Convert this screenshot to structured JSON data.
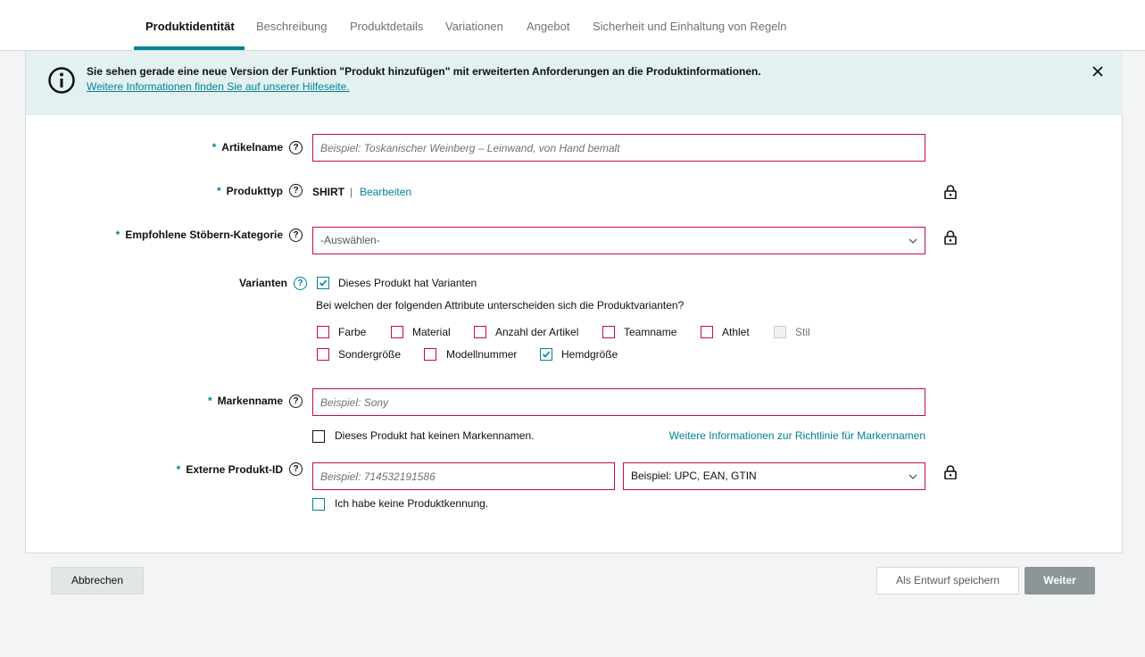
{
  "tabs": [
    {
      "label": "Produktidentität",
      "active": true
    },
    {
      "label": "Beschreibung",
      "active": false
    },
    {
      "label": "Produktdetails",
      "active": false
    },
    {
      "label": "Variationen",
      "active": false
    },
    {
      "label": "Angebot",
      "active": false
    },
    {
      "label": "Sicherheit und Einhaltung von Regeln",
      "active": false
    }
  ],
  "banner": {
    "title": "Sie sehen gerade eine neue Version der Funktion \"Produkt hinzufügen\" mit erweiterten Anforderungen an die Produktinformationen.",
    "link": "Weitere Informationen finden Sie auf unserer Hilfeseite."
  },
  "form": {
    "required_mark": "*",
    "help_glyph": "?",
    "item_name": {
      "label": "Artikelname",
      "placeholder": "Beispiel: Toskanischer Weinberg – Leinwand, von Hand bemalt",
      "value": ""
    },
    "product_type": {
      "label": "Produkttyp",
      "value": "SHIRT",
      "separator": "|",
      "edit_link": "Bearbeiten"
    },
    "browse_category": {
      "label": "Empfohlene Stöbern-Kategorie",
      "selected": "-Auswählen-"
    },
    "variants": {
      "label": "Varianten",
      "has_variants_label": "Dieses Produkt hat Varianten",
      "has_variants_checked": true,
      "question": "Bei welchen der folgenden Attribute unterscheiden sich die Produktvarianten?",
      "options": [
        {
          "label": "Farbe",
          "checked": false,
          "disabled": false
        },
        {
          "label": "Material",
          "checked": false,
          "disabled": false
        },
        {
          "label": "Anzahl der Artikel",
          "checked": false,
          "disabled": false
        },
        {
          "label": "Teamname",
          "checked": false,
          "disabled": false
        },
        {
          "label": "Athlet",
          "checked": false,
          "disabled": false
        },
        {
          "label": "Stil",
          "checked": false,
          "disabled": true
        },
        {
          "label": "Sondergröße",
          "checked": false,
          "disabled": false
        },
        {
          "label": "Modellnummer",
          "checked": false,
          "disabled": false
        },
        {
          "label": "Hemdgröße",
          "checked": true,
          "disabled": false
        }
      ]
    },
    "brand": {
      "label": "Markenname",
      "placeholder": "Beispiel: Sony",
      "value": "",
      "no_brand_label": "Dieses Produkt hat keinen Markennamen.",
      "no_brand_checked": false,
      "policy_link": "Weitere Informationen zur Richtlinie für Markennamen"
    },
    "external_id": {
      "label": "Externe Produkt-ID",
      "placeholder": "Beispiel: 714532191586",
      "value": "",
      "type_selected": "Beispiel: UPC, EAN, GTIN",
      "no_id_label": "Ich habe keine Produktkennung.",
      "no_id_checked": false
    }
  },
  "footer": {
    "cancel": "Abbrechen",
    "save_draft": "Als Entwurf speichern",
    "next": "Weiter"
  },
  "colors": {
    "accent": "#008296",
    "error_border": "#c40b4a",
    "banner_bg": "#e4f1f1",
    "next_button": "#8d9696"
  },
  "icons": [
    "info-icon",
    "close-icon",
    "help-icon",
    "lock-icon",
    "chevron-down-icon",
    "checkmark-icon"
  ]
}
